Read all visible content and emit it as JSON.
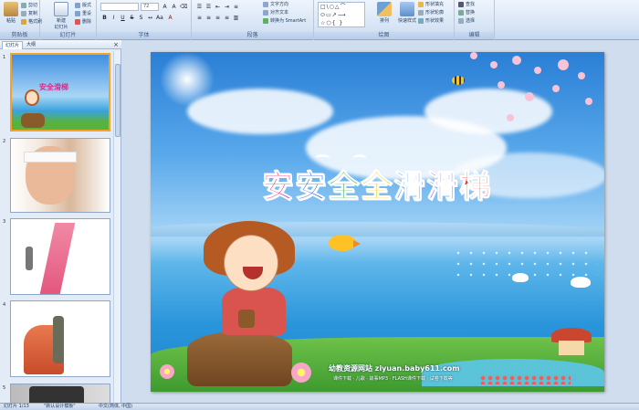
{
  "ribbon": {
    "clipboard": {
      "label": "剪贴板",
      "paste": "粘贴",
      "cut": "剪切",
      "copy": "复制",
      "format_painter": "格式刷"
    },
    "slides": {
      "label": "幻灯片",
      "new_slide": "新建\n幻灯片",
      "layout": "版式",
      "reset": "重设",
      "delete": "删除"
    },
    "font": {
      "label": "字体",
      "font_name": "",
      "font_size": "72"
    },
    "paragraph": {
      "label": "段落",
      "text_direction": "文字方向",
      "align_text": "对齐文本",
      "convert_smartart": "转换为 SmartArt"
    },
    "drawing": {
      "label": "绘图",
      "arrange": "排列",
      "quick_styles": "快速样式",
      "shape_fill": "形状填充",
      "shape_outline": "形状轮廓",
      "shape_effects": "形状效果"
    },
    "editing": {
      "label": "编辑",
      "find": "查找",
      "replace": "替换",
      "select": "选择"
    }
  },
  "pane": {
    "tabs": [
      "幻灯片",
      "大纲"
    ],
    "close": "×",
    "thumbnails": [
      {
        "number": "1"
      },
      {
        "number": "2"
      },
      {
        "number": "3"
      },
      {
        "number": "4"
      },
      {
        "number": "5"
      }
    ]
  },
  "slide": {
    "title_chars": [
      "安",
      "安",
      "全",
      "全",
      "滑",
      "滑",
      "梯"
    ],
    "title_colors": [
      "#e02b8a",
      "#2a62d8",
      "#17a43a",
      "#f2c200",
      "#1d7fe0",
      "#8a2bd0",
      "#e6331f"
    ],
    "watermark": "幼教资源网站  ziyuan.baby611.com",
    "watermark_sub": "课件下载 · 儿歌 · 故事MP3 · FLASH课件下载 · 试卷下载等"
  },
  "status": {
    "slide_info": "幻灯片 1/13",
    "theme": "\"默认设计模板\"",
    "language": "中文(简体, 中国)"
  }
}
